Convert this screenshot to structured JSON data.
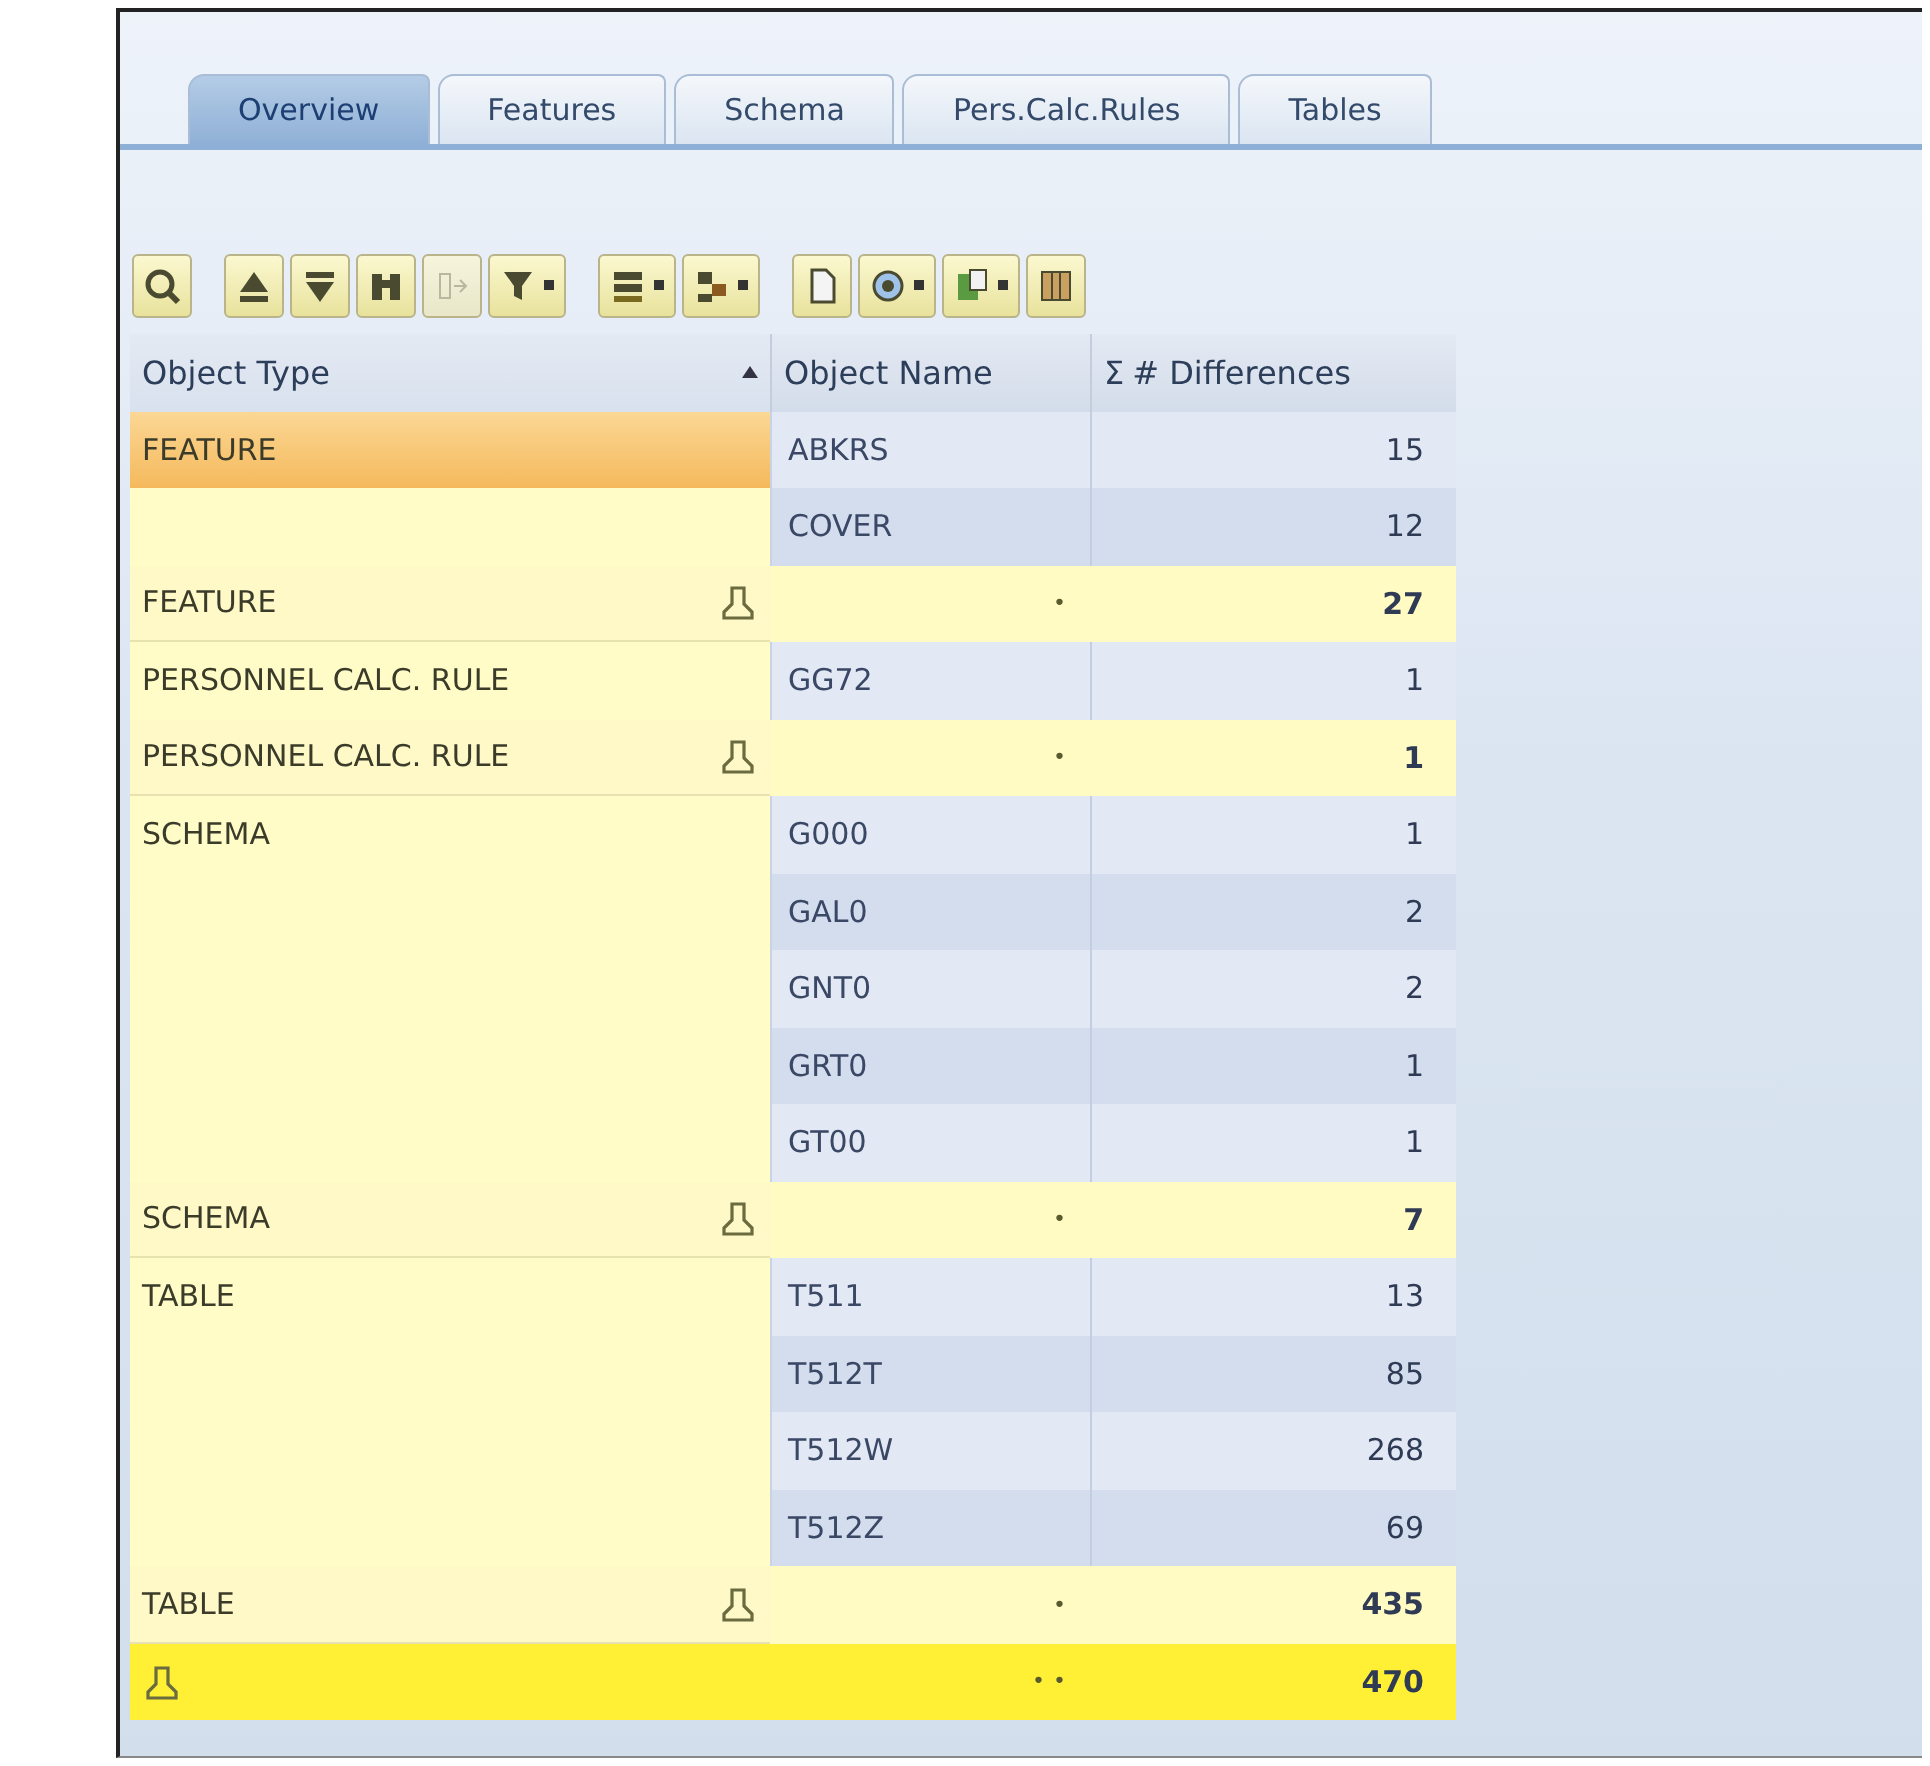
{
  "tabs": [
    {
      "label": "Overview",
      "selected": true
    },
    {
      "label": "Features",
      "selected": false
    },
    {
      "label": "Schema",
      "selected": false
    },
    {
      "label": "Pers.Calc.Rules",
      "selected": false
    },
    {
      "label": "Tables",
      "selected": false
    }
  ],
  "toolbar": [
    [
      {
        "menu": false
      }
    ],
    [
      {
        "menu": false
      },
      {
        "menu": false
      },
      {
        "menu": false
      },
      {
        "menu": false,
        "disabled": true
      },
      {
        "menu": true
      }
    ],
    [
      {
        "menu": true
      },
      {
        "menu": true
      }
    ],
    [
      {
        "menu": false
      },
      {
        "menu": true
      },
      {
        "menu": true
      },
      {
        "menu": false
      }
    ]
  ],
  "table": {
    "columns": [
      {
        "label": "Object Type",
        "sorted": true
      },
      {
        "label": "Object Name"
      },
      {
        "label": "# Differences",
        "prefix": "Σ"
      }
    ],
    "rows": [
      {
        "kind": "item",
        "type": "FEATURE",
        "selected": true,
        "name": "ABKRS",
        "value": "15"
      },
      {
        "kind": "item",
        "selected": false,
        "name": "COVER",
        "value": "12"
      },
      {
        "kind": "subtotal",
        "type": "FEATURE",
        "selected": false,
        "mark": "•",
        "value": "27"
      },
      {
        "kind": "item",
        "type": "PERSONNEL CALC. RULE",
        "selected": false,
        "name": "GG72",
        "value": "1"
      },
      {
        "kind": "subtotal",
        "type": "PERSONNEL CALC. RULE",
        "selected": false,
        "mark": "•",
        "value": "1"
      },
      {
        "kind": "item",
        "type": "SCHEMA",
        "selected": false,
        "name": "G000",
        "value": "1"
      },
      {
        "kind": "item",
        "selected": false,
        "name": "GAL0",
        "value": "2"
      },
      {
        "kind": "item",
        "selected": false,
        "name": "GNT0",
        "value": "2"
      },
      {
        "kind": "item",
        "selected": false,
        "name": "GRT0",
        "value": "1"
      },
      {
        "kind": "item",
        "selected": false,
        "name": "GT00",
        "value": "1"
      },
      {
        "kind": "subtotal",
        "type": "SCHEMA",
        "selected": false,
        "mark": "•",
        "value": "7"
      },
      {
        "kind": "item",
        "type": "TABLE",
        "selected": false,
        "name": "T511",
        "value": "13"
      },
      {
        "kind": "item",
        "selected": false,
        "name": "T512T",
        "value": "85"
      },
      {
        "kind": "item",
        "selected": false,
        "name": "T512W",
        "value": "268"
      },
      {
        "kind": "item",
        "selected": false,
        "name": "T512Z",
        "value": "69"
      },
      {
        "kind": "subtotal",
        "type": "TABLE",
        "selected": false,
        "mark": "•",
        "value": "435"
      },
      {
        "kind": "total",
        "selected": false,
        "mark": "••",
        "value": "470"
      }
    ]
  }
}
